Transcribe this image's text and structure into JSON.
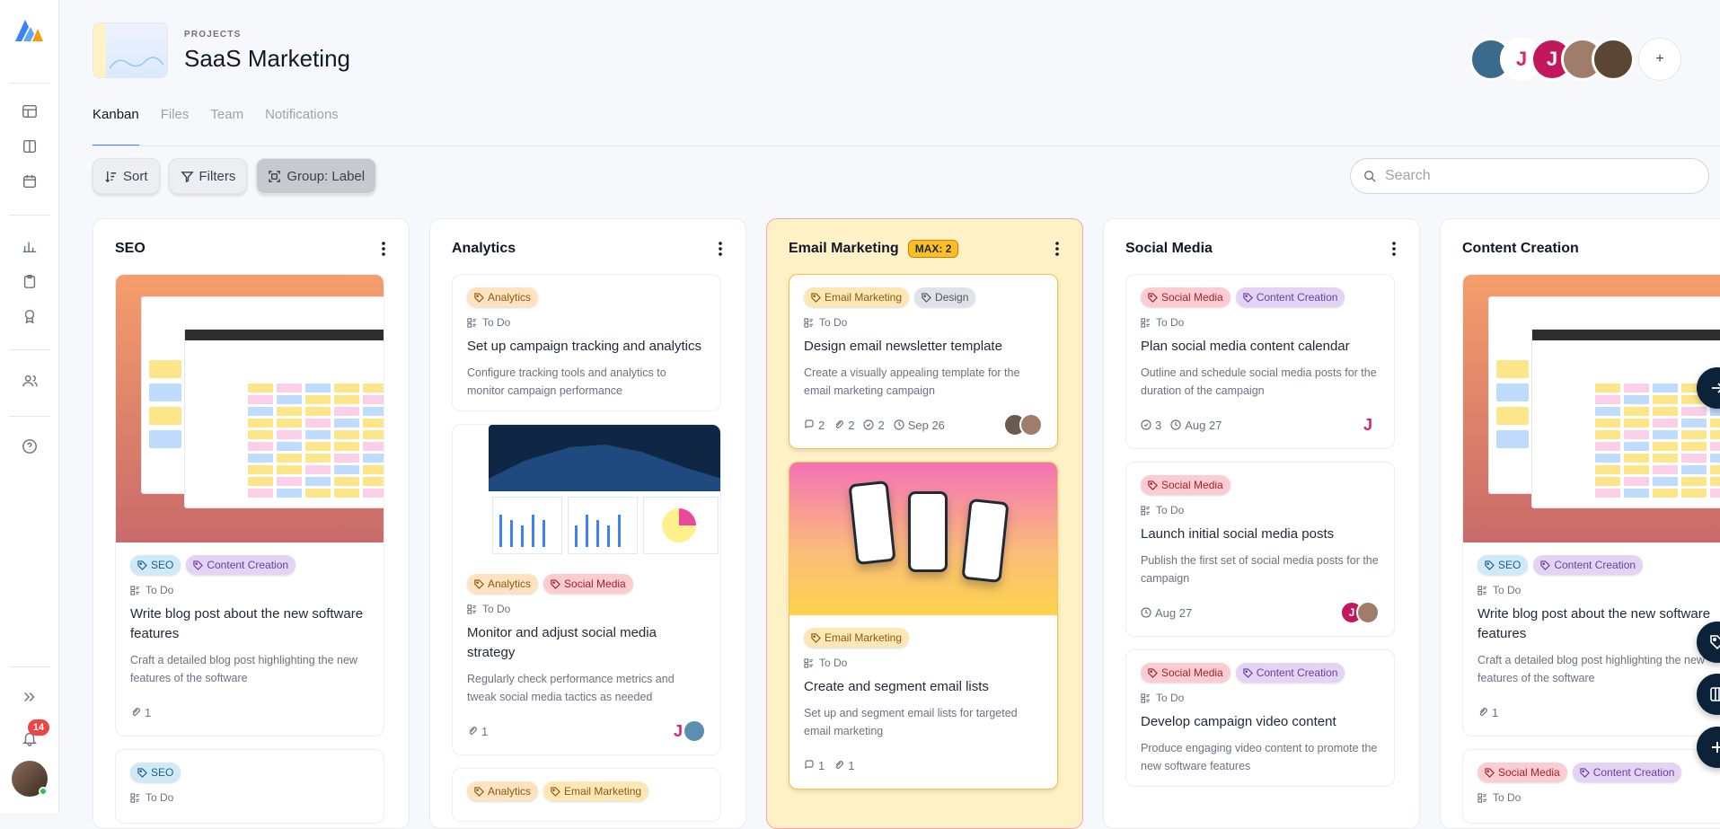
{
  "sidebar": {
    "notification_count": "14"
  },
  "header": {
    "eyebrow": "PROJECTS",
    "title": "SaaS Marketing",
    "add_member": "+"
  },
  "members": [
    {
      "initial": "",
      "color": "#3b6b8c"
    },
    {
      "initial": "J",
      "color": "#ffffff",
      "fg": "#d6246e"
    },
    {
      "initial": "J",
      "color": "#c2185b"
    },
    {
      "initial": "",
      "color": "#a07c6a"
    },
    {
      "initial": "",
      "color": "#5b4636"
    }
  ],
  "tabs": [
    {
      "label": "Kanban",
      "active": true
    },
    {
      "label": "Files"
    },
    {
      "label": "Team"
    },
    {
      "label": "Notifications"
    }
  ],
  "toolbar": {
    "sort": "Sort",
    "filters": "Filters",
    "group": "Group: Label"
  },
  "search": {
    "placeholder": "Search"
  },
  "tag_colors": {
    "SEO": {
      "bg": "#cfe9f7",
      "fg": "#1f5f85"
    },
    "Content Creation": {
      "bg": "#e3d4f3",
      "fg": "#6b3fa0"
    },
    "Analytics": {
      "bg": "#fde3bf",
      "fg": "#8a5a12"
    },
    "Social Media": {
      "bg": "#fbcdd2",
      "fg": "#a3222f"
    },
    "Email Marketing": {
      "bg": "#fde8b5",
      "fg": "#8a5a12"
    },
    "Design": {
      "bg": "#dfe3e8",
      "fg": "#4b5563"
    }
  },
  "columns": [
    {
      "title": "SEO",
      "max": "",
      "highlight": false,
      "cards": [
        {
          "image": "cal",
          "tags": [
            "SEO",
            "Content Creation"
          ],
          "status": "To Do",
          "title": "Write blog post about the new software features",
          "desc": "Craft a detailed blog post highlighting the new features of the software",
          "metas": [
            {
              "icon": "clip",
              "v": "1"
            }
          ],
          "avatars": []
        },
        {
          "image": "",
          "tags": [
            "SEO"
          ],
          "status": "To Do",
          "title": "",
          "desc": "",
          "metas": [],
          "avatars": []
        }
      ]
    },
    {
      "title": "Analytics",
      "max": "",
      "highlight": false,
      "cards": [
        {
          "image": "",
          "tags": [
            "Analytics"
          ],
          "status": "To Do",
          "title": "Set up campaign tracking and analytics",
          "desc": "Configure tracking tools and analytics to monitor campaign performance",
          "metas": [],
          "avatars": []
        },
        {
          "image": "dash",
          "tags": [
            "Analytics",
            "Social Media"
          ],
          "status": "To Do",
          "title": "Monitor and adjust social media strategy",
          "desc": "Regularly check performance metrics and tweak social media tactics as needed",
          "metas": [
            {
              "icon": "clip",
              "v": "1"
            }
          ],
          "avatars": [
            {
              "i": "J",
              "c": "#ffffff",
              "f": "#d6246e"
            },
            {
              "i": "",
              "c": "#5b8fb0"
            }
          ]
        },
        {
          "image": "",
          "tags": [
            "Analytics",
            "Email Marketing"
          ],
          "status": "",
          "title": "",
          "desc": "",
          "metas": [],
          "avatars": []
        }
      ]
    },
    {
      "title": "Email Marketing",
      "max": "MAX: 2",
      "highlight": true,
      "cards": [
        {
          "image": "",
          "tags": [
            "Email Marketing",
            "Design"
          ],
          "status": "To Do",
          "title": "Design email newsletter template",
          "desc": "Create a visually appealing template for the email marketing campaign",
          "metas": [
            {
              "icon": "comment",
              "v": "2"
            },
            {
              "icon": "clip",
              "v": "2"
            },
            {
              "icon": "check",
              "v": "2"
            },
            {
              "icon": "clock",
              "v": "Sep 26"
            }
          ],
          "avatars": [
            {
              "i": "",
              "c": "#6b5a4e"
            },
            {
              "i": "",
              "c": "#a07c6a"
            }
          ],
          "selected": true
        },
        {
          "image": "phones",
          "tags": [
            "Email Marketing"
          ],
          "status": "To Do",
          "title": "Create and segment email lists",
          "desc": "Set up and segment email lists for targeted email marketing",
          "metas": [
            {
              "icon": "comment",
              "v": "1"
            },
            {
              "icon": "clip",
              "v": "1"
            }
          ],
          "avatars": [],
          "selected": true
        }
      ]
    },
    {
      "title": "Social Media",
      "max": "",
      "highlight": false,
      "cards": [
        {
          "image": "",
          "tags": [
            "Social Media",
            "Content Creation"
          ],
          "status": "To Do",
          "title": "Plan social media content calendar",
          "desc": "Outline and schedule social media posts for the duration of the campaign",
          "metas": [
            {
              "icon": "check",
              "v": "3"
            },
            {
              "icon": "clock",
              "v": "Aug 27"
            }
          ],
          "avatars": [
            {
              "i": "J",
              "c": "#ffffff",
              "f": "#d6246e"
            }
          ]
        },
        {
          "image": "",
          "tags": [
            "Social Media"
          ],
          "status": "To Do",
          "title": "Launch initial social media posts",
          "desc": "Publish the first set of social media posts for the campaign",
          "metas": [
            {
              "icon": "clock",
              "v": "Aug 27"
            }
          ],
          "avatars": [
            {
              "i": "J",
              "c": "#c2185b"
            },
            {
              "i": "",
              "c": "#a07c6a"
            }
          ]
        },
        {
          "image": "",
          "tags": [
            "Social Media",
            "Content Creation"
          ],
          "status": "To Do",
          "title": "Develop campaign video content",
          "desc": "Produce engaging video content to promote the new software features",
          "metas": [],
          "avatars": []
        }
      ]
    },
    {
      "title": "Content Creation",
      "max": "",
      "highlight": false,
      "cards": [
        {
          "image": "cal",
          "tags": [
            "SEO",
            "Content Creation"
          ],
          "status": "To Do",
          "title": "Write blog post about the new software features",
          "desc": "Craft a detailed blog post highlighting the new features of the software",
          "metas": [
            {
              "icon": "clip",
              "v": "1"
            }
          ],
          "avatars": []
        },
        {
          "image": "",
          "tags": [
            "Social Media",
            "Content Creation"
          ],
          "status": "To Do",
          "title": "",
          "desc": "",
          "metas": [],
          "avatars": []
        }
      ]
    }
  ]
}
